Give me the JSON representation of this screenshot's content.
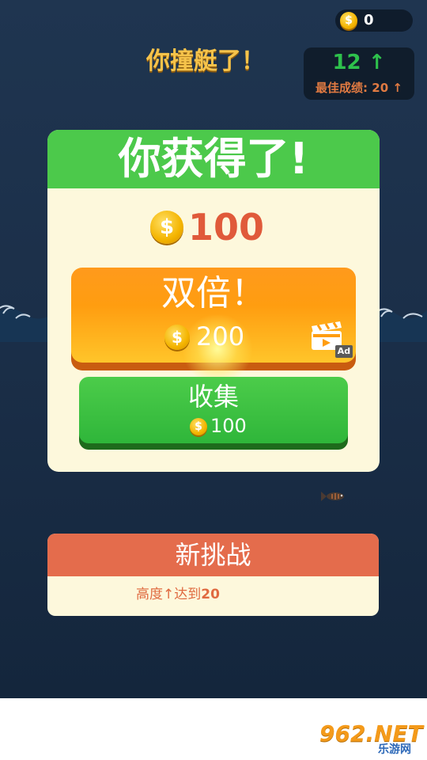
{
  "hud": {
    "coins": "0",
    "title": "你撞艇了！",
    "score_current": "12",
    "score_arrow": "↑",
    "best_label": "最佳成绩:",
    "best_value": "20",
    "best_arrow": "↑"
  },
  "reward_card": {
    "title": "你获得了!",
    "amount": "100",
    "double_button": {
      "label": "双倍！",
      "amount": "200",
      "ad_tag": "Ad"
    },
    "collect_button": {
      "label": "收集",
      "amount": "100"
    }
  },
  "challenge": {
    "title": "新挑战",
    "text_prefix": "高度↑达到",
    "text_value": "20"
  },
  "watermark": {
    "big": "962.NET",
    "small": "乐游网"
  },
  "colors": {
    "background": "#1b2f49",
    "green": "#4cc94b",
    "orange": "#ff9d10",
    "challenge_red": "#e46c4c",
    "card_cream": "#fdf8dc",
    "reward_red": "#e05a3a"
  }
}
